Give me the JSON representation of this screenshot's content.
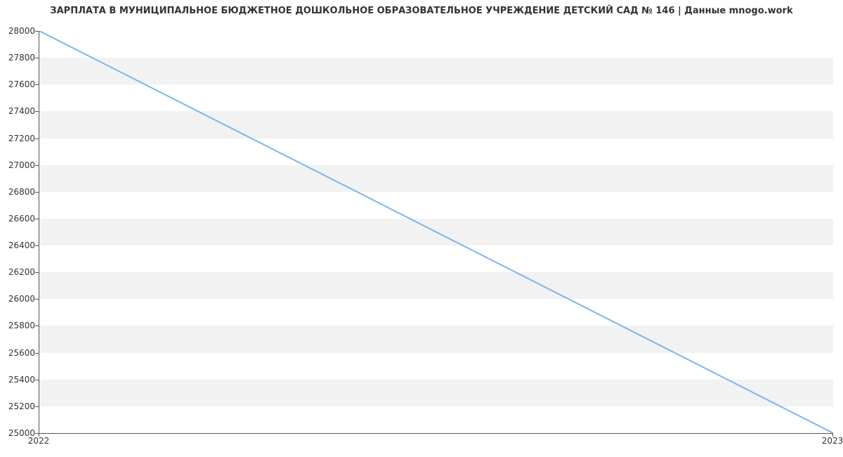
{
  "chart_data": {
    "type": "line",
    "title": "ЗАРПЛАТА В МУНИЦИПАЛЬНОЕ БЮДЖЕТНОЕ ДОШКОЛЬНОЕ ОБРАЗОВАТЕЛЬНОЕ УЧРЕЖДЕНИЕ ДЕТСКИЙ САД № 146 | Данные mnogo.work",
    "x": [
      "2022",
      "2023"
    ],
    "values": [
      28000,
      25000
    ],
    "xlabel": "",
    "ylabel": "",
    "ylim": [
      25000,
      28000
    ],
    "y_ticks": [
      25000,
      25200,
      25400,
      25600,
      25800,
      26000,
      26200,
      26400,
      26600,
      26800,
      27000,
      27200,
      27400,
      27600,
      27800,
      28000
    ],
    "x_ticks": [
      "2022",
      "2023"
    ],
    "line_color": "#7cb5ec",
    "band_color": "#f2f2f2"
  }
}
